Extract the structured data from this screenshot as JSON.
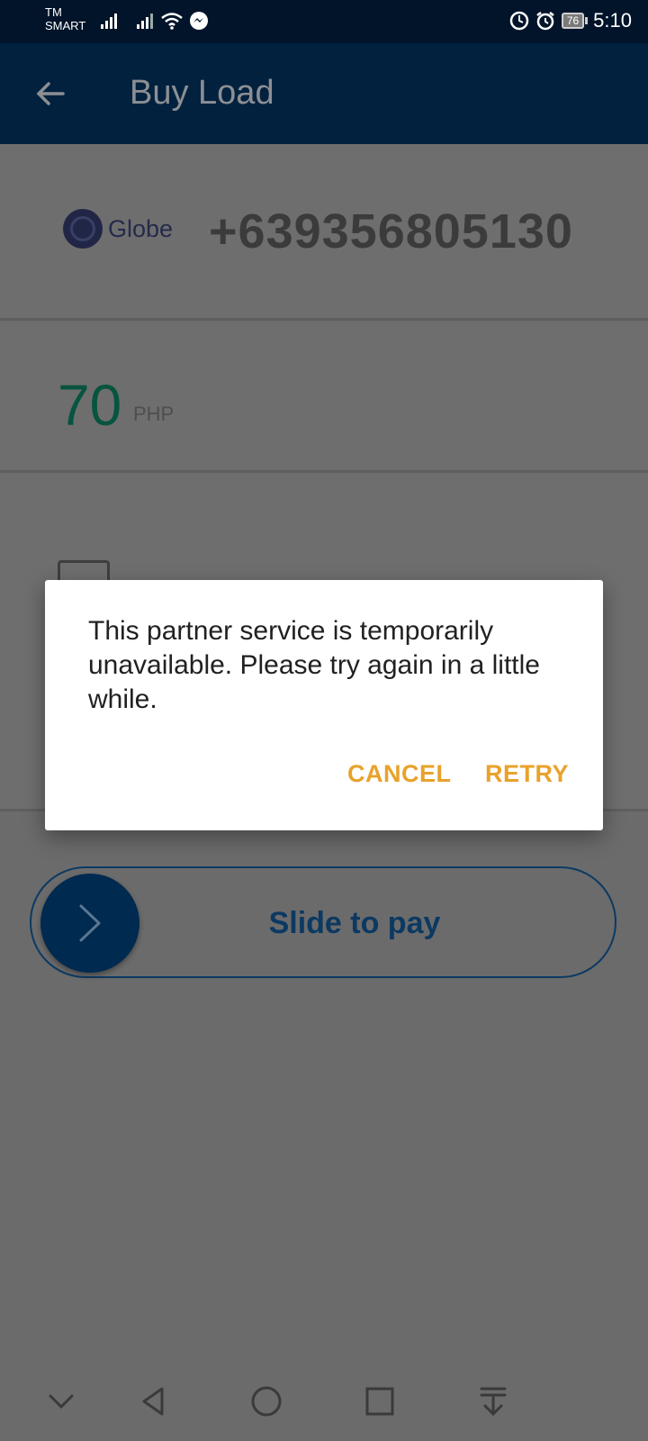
{
  "status_bar": {
    "carrier_line1": "TM",
    "carrier_line2": "SMART",
    "battery": "76",
    "time": "5:10"
  },
  "app_bar": {
    "title": "Buy Load"
  },
  "phone_card": {
    "network_logo_text": "Globe",
    "number": "+639356805130"
  },
  "amount_card": {
    "amount": "70",
    "currency": "PHP"
  },
  "wallet_card": {
    "icon": "wallet-icon"
  },
  "slider": {
    "label": "Slide to pay"
  },
  "dialog": {
    "message": "This partner service is temporarily unavailable. Please try again in a little while.",
    "cancel_label": "CANCEL",
    "retry_label": "RETRY"
  },
  "colors": {
    "app_bar": "#01213f",
    "accent_button": "#e8a22a",
    "amount": "#07543f"
  }
}
